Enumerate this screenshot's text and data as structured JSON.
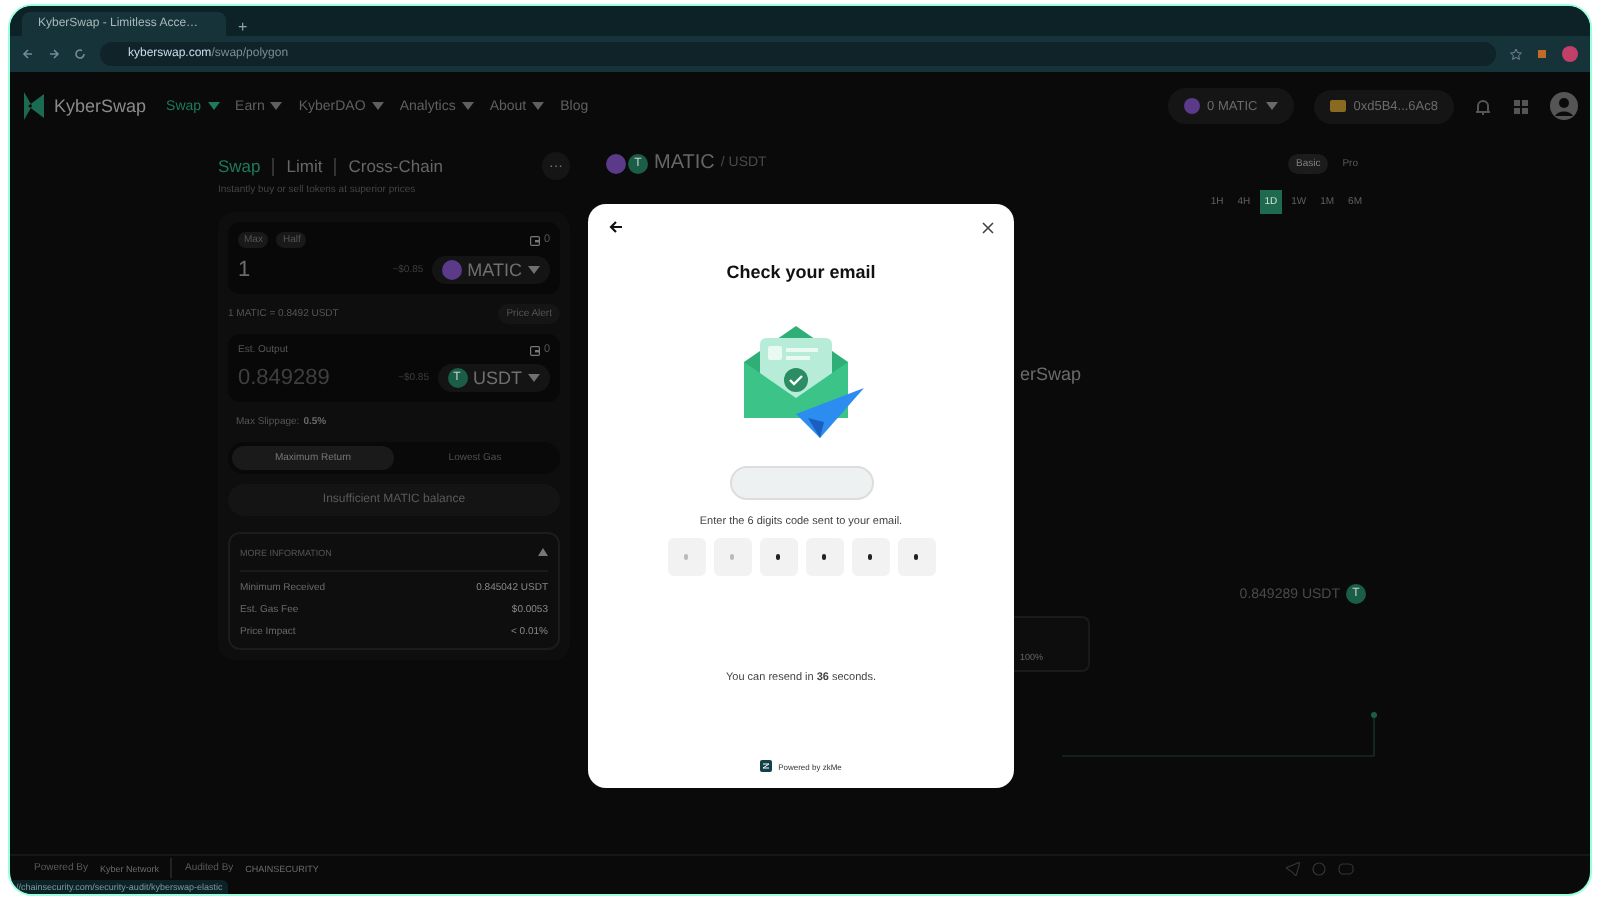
{
  "browser": {
    "tab_title": "KyberSwap - Limitless Acce…",
    "new_tab": "+",
    "url_host": "kyberswap.com",
    "url_path": "/swap/polygon",
    "status_link": "//chainsecurity.com/security-audit/kyberswap-elastic"
  },
  "header": {
    "logo": "KyberSwap",
    "nav": [
      {
        "label": "Swap",
        "selected": true,
        "dropdown": true
      },
      {
        "label": "Earn",
        "selected": false,
        "dropdown": true
      },
      {
        "label": "KyberDAO",
        "selected": false,
        "dropdown": true
      },
      {
        "label": "Analytics",
        "selected": false,
        "dropdown": true
      },
      {
        "label": "About",
        "selected": false,
        "dropdown": true
      },
      {
        "label": "Blog",
        "selected": false,
        "dropdown": false
      }
    ],
    "network": "0 MATIC",
    "wallet": "0xd5B4...6Ac8"
  },
  "swap": {
    "tabs": [
      {
        "label": "Swap",
        "selected": true
      },
      {
        "label": "Limit",
        "selected": false
      },
      {
        "label": "Cross-Chain",
        "selected": false
      }
    ],
    "more": "···",
    "subtitle": "Instantly buy or sell tokens at superior prices",
    "input": {
      "chips": [
        "Max",
        "Half"
      ],
      "balance": "0",
      "amount": "1",
      "usd": "~$0.85",
      "token": "MATIC"
    },
    "rate": "1 MATIC = 0.8492 USDT",
    "price_alert": "Price Alert",
    "output": {
      "label": "Est. Output",
      "balance": "0",
      "amount": "0.849289",
      "usd": "~$0.85",
      "token": "USDT",
      "token_letter": "T"
    },
    "slippage_label": "Max Slippage:",
    "slippage": "0.5%",
    "modes": [
      {
        "label": "Maximum Return",
        "selected": true
      },
      {
        "label": "Lowest Gas",
        "selected": false
      }
    ],
    "action": {
      "label": "Insufficient MATIC balance",
      "disabled": true
    },
    "info": {
      "title": "MORE INFORMATION",
      "expanded": true,
      "rows": [
        {
          "label": "Minimum Received",
          "value": "0.845042 USDT"
        },
        {
          "label": "Est. Gas Fee",
          "value": "$0.0053"
        },
        {
          "label": "Price Impact",
          "value": "< 0.01%"
        }
      ]
    }
  },
  "chart": {
    "base": "MATIC",
    "quote": "/ USDT",
    "token_letter": "T",
    "route_token_letter": "T",
    "views": [
      {
        "label": "Basic",
        "selected": true
      },
      {
        "label": "Pro",
        "selected": false
      }
    ],
    "ranges": [
      {
        "label": "1H",
        "selected": false
      },
      {
        "label": "4H",
        "selected": false
      },
      {
        "label": "1D",
        "selected": true
      },
      {
        "label": "1W",
        "selected": false
      },
      {
        "label": "1M",
        "selected": false
      },
      {
        "label": "6M",
        "selected": false
      }
    ],
    "behind_text": "erSwap",
    "route_output": "0.849289 USDT",
    "route_share": "100%"
  },
  "footer": {
    "powered": "Powered By",
    "powered_logo": "Kyber Network",
    "audited": "Audited By",
    "auditor": "CHAINSECURITY"
  },
  "modal": {
    "title": "Check your email",
    "instruction": "Enter the 6 digits code sent to your email.",
    "code": [
      {
        "filled": false
      },
      {
        "filled": false
      },
      {
        "filled": true
      },
      {
        "filled": true
      },
      {
        "filled": true
      },
      {
        "filled": true
      }
    ],
    "resend": "You can resend in **36** seconds.",
    "powered": "Powered by zkMe"
  }
}
